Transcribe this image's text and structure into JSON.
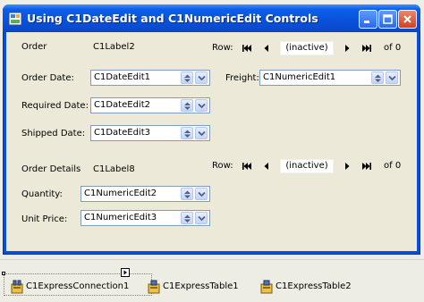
{
  "window": {
    "title": "Using C1DateEdit and C1NumericEdit Controls",
    "buttons": {
      "minimize": "minimize-icon",
      "maximize": "maximize-icon",
      "close": "close-icon"
    }
  },
  "orders": {
    "order_label": "Order",
    "order_value": "C1Label2",
    "order_date_label": "Order Date:",
    "order_date_value": "C1DateEdit1",
    "required_date_label": "Required Date:",
    "required_date_value": "C1DateEdit2",
    "shipped_date_label": "Shipped Date:",
    "shipped_date_value": "C1DateEdit3",
    "freight_label": "Freight:",
    "freight_value": "C1NumericEdit1"
  },
  "navigator_top": {
    "row_label": "Row:",
    "state": "(inactive)",
    "of_label": "of 0"
  },
  "details": {
    "label": "Order Details",
    "value": "C1Label8",
    "quantity_label": "Quantity:",
    "quantity_value": "C1NumericEdit2",
    "unit_price_label": "Unit Price:",
    "unit_price_value": "C1NumericEdit3"
  },
  "navigator_bottom": {
    "row_label": "Row:",
    "state": "(inactive)",
    "of_label": "of 0"
  },
  "tray": {
    "connection": "C1ExpressConnection1",
    "table1": "C1ExpressTable1",
    "table2": "C1ExpressTable2"
  },
  "colors": {
    "title_bar": "#0a52dc",
    "client": "#ece9d8",
    "field_border": "#7f9db9",
    "close_button": "#c94521"
  }
}
